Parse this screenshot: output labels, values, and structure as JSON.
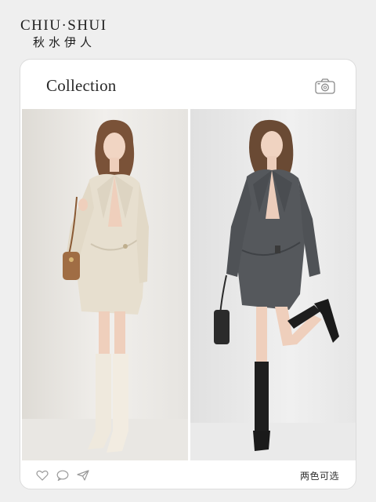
{
  "brand": {
    "name_en": "CHIU·SHUI",
    "name_cn": "秋水伊人"
  },
  "card": {
    "title": "Collection",
    "camera_icon": "camera-icon"
  },
  "photos": [
    {
      "alt_color": "cream",
      "icon": "photo"
    },
    {
      "alt_color": "charcoal-grey",
      "icon": "photo"
    }
  ],
  "bottom_bar": {
    "icons": [
      "heart-icon",
      "comment-icon",
      "share-icon"
    ],
    "color_choice": "两色可选"
  },
  "colors": {
    "background": "#efefef",
    "card": "#ffffff",
    "cream_dress": "#e7dfcf",
    "grey_dress": "#55585c"
  }
}
